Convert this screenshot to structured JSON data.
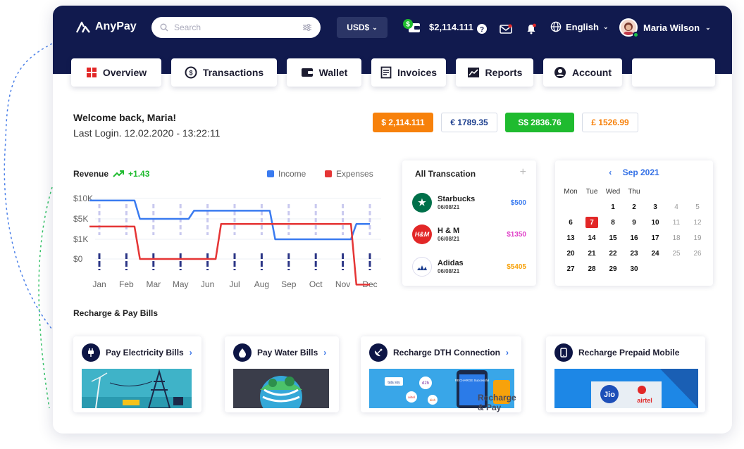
{
  "app": {
    "name": "AnyPay"
  },
  "header": {
    "search_placeholder": "Search",
    "currency": "USD$",
    "wallet_balance": "$2,114.111",
    "language": "English",
    "user_name": "Maria Wilson"
  },
  "tabs": [
    {
      "label": "Overview"
    },
    {
      "label": "Transactions"
    },
    {
      "label": "Wallet"
    },
    {
      "label": "Invoices"
    },
    {
      "label": "Reports"
    },
    {
      "label": "Account"
    },
    {
      "label": ""
    }
  ],
  "welcome": {
    "greeting": "Welcome back, Maria!",
    "last_login": "Last Login. 12.02.2020 - 13:22:11"
  },
  "balances": [
    {
      "text": "$ 2,114.111",
      "color": "#f7810b"
    },
    {
      "text": "€ 1789.35",
      "color": "#1d3f8f"
    },
    {
      "text": "S$ 2836.76",
      "color": "#1fbb2f"
    },
    {
      "text": "£ 1526.99",
      "color": "#f7810b"
    }
  ],
  "revenue": {
    "label": "Revenue",
    "change": "+1.43",
    "legend_income": "Income",
    "legend_expenses": "Expenses"
  },
  "chart_data": {
    "type": "line",
    "categories": [
      "Jan",
      "Feb",
      "Mar",
      "May",
      "Jun",
      "Jul",
      "Aug",
      "Sep",
      "Oct",
      "Nov",
      "Dec"
    ],
    "y_ticks": [
      "$10K",
      "$5K",
      "$1K",
      "$0"
    ],
    "series": [
      {
        "name": "Income",
        "color": "#3a7bf0",
        "values": [
          9.5,
          9.5,
          5.0,
          5.0,
          7.0,
          7.0,
          7.0,
          1.0,
          1.0,
          1.0,
          4.0
        ]
      },
      {
        "name": "Expenses",
        "color": "#e53535",
        "values": [
          3.5,
          3.5,
          0.0,
          0.0,
          0.0,
          4.0,
          4.0,
          4.0,
          4.0,
          4.0,
          -1.3
        ]
      }
    ]
  },
  "transactions": {
    "title": "All Transcation",
    "items": [
      {
        "name": "Starbucks",
        "date": "06/08/21",
        "amount": "$500",
        "amount_color": "#3a7bf0",
        "logo_color": "#00704a",
        "logo_text": "★"
      },
      {
        "name": "H & M",
        "date": "06/08/21",
        "amount": "$1350",
        "amount_color": "#e040c8",
        "logo_color": "#e22727",
        "logo_text": "H&M"
      },
      {
        "name": "Adidas",
        "date": "06/08/21",
        "amount": "$5405",
        "amount_color": "#f7a20b",
        "logo_color": "#ffffff",
        "logo_text": ""
      }
    ]
  },
  "calendar": {
    "month": "Sep 2021",
    "weekdays": [
      "Mon",
      "Tue",
      "Wed",
      "Thu",
      "",
      "",
      ""
    ],
    "days": [
      [
        "",
        "",
        "1",
        "2",
        "3",
        "4",
        "5"
      ],
      [
        "6",
        "7",
        "8",
        "9",
        "10",
        "11",
        "12"
      ],
      [
        "13",
        "14",
        "15",
        "16",
        "17",
        "18",
        "19"
      ],
      [
        "20",
        "21",
        "22",
        "23",
        "24",
        "25",
        "26"
      ],
      [
        "27",
        "28",
        "29",
        "30",
        "",
        "",
        ""
      ]
    ],
    "today": "7"
  },
  "bills": {
    "title": "Recharge & Pay Bills",
    "items": [
      {
        "label": "Pay Electricity Bills"
      },
      {
        "label": "Pay Water Bills"
      },
      {
        "label": "Recharge DTH Connection"
      },
      {
        "label": "Recharge Prepaid Mobile"
      }
    ],
    "dth_banner_text": "RECHARGE Successful",
    "overlay_text": "Recharge & Pay",
    "mobile_logos": [
      "Jio",
      "airtel"
    ],
    "dth_logos": [
      "tata sky",
      "d2h",
      "airtel",
      "dish"
    ]
  }
}
